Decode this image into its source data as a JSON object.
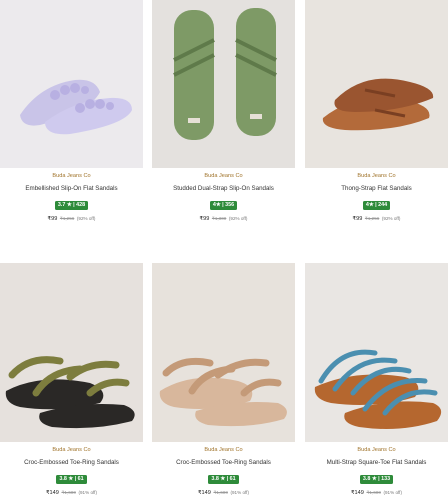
{
  "products": [
    {
      "brand": "Buda Jeans Co",
      "name": "Embellished Slip-On Flat Sandals",
      "rating": "3.7 ★ | 428",
      "price": "₹99",
      "mrp": "₹1,256",
      "off": "(92% off)",
      "image": "lavender-embellished-slides"
    },
    {
      "brand": "Buda Jeans Co",
      "name": "Studded Dual-Strap Slip-On Sandals",
      "rating": "4★ | 356",
      "price": "₹99",
      "mrp": "₹1,300",
      "off": "(92% off)",
      "image": "green-studded-slides"
    },
    {
      "brand": "Buda Jeans Co",
      "name": "Thong-Strap Flat Sandals",
      "rating": "4★ | 244",
      "price": "₹99",
      "mrp": "₹1,256",
      "off": "(92% off)",
      "image": "brown-thong-sandals"
    },
    {
      "brand": "Buda Jeans Co",
      "name": "Croc-Embossed Toe-Ring Sandals",
      "rating": "3.8 ★ | 61",
      "price": "₹149",
      "mrp": "₹1,600",
      "off": "(91% off)",
      "image": "olive-black-toe-ring-sandals"
    },
    {
      "brand": "Buda Jeans Co",
      "name": "Croc-Embossed Toe-Ring Sandals",
      "rating": "3.8 ★ | 61",
      "price": "₹149",
      "mrp": "₹1,600",
      "off": "(91% off)",
      "image": "beige-toe-ring-sandals"
    },
    {
      "brand": "Buda Jeans Co",
      "name": "Multi-Strap Square-Toe Flat Sandals",
      "rating": "3.8 ★ | 133",
      "price": "₹149",
      "mrp": "₹1,600",
      "off": "(91% off)",
      "image": "blue-multi-strap-sandals"
    }
  ],
  "colors": {
    "rating_badge": "#2e8b3a",
    "brand_text": "#a0732a"
  }
}
